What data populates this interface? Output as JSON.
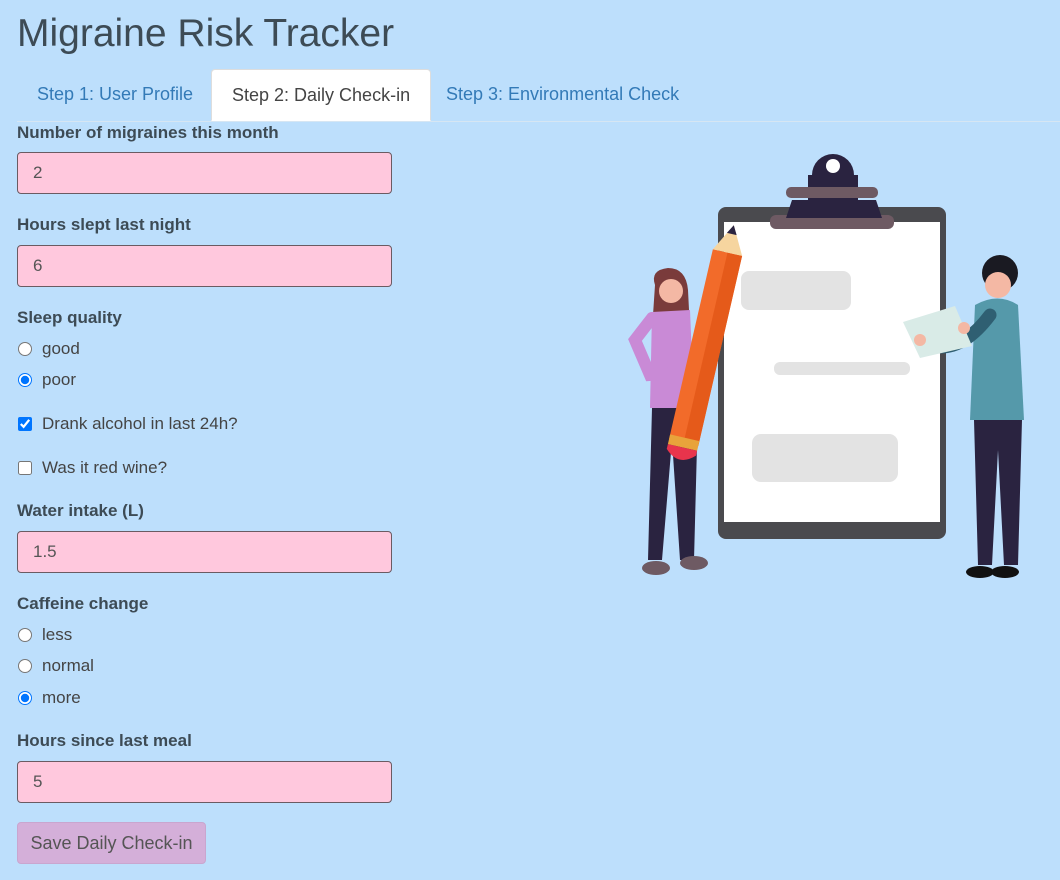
{
  "app": {
    "title": "Migraine Risk Tracker"
  },
  "tabs": [
    {
      "label": "Step 1: User Profile",
      "active": false
    },
    {
      "label": "Step 2: Daily Check-in",
      "active": true
    },
    {
      "label": "Step 3: Environmental Check",
      "active": false
    }
  ],
  "form": {
    "migraines": {
      "label": "Number of migraines this month",
      "value": "2"
    },
    "sleep_hours": {
      "label": "Hours slept last night",
      "value": "6"
    },
    "sleep_quality": {
      "label": "Sleep quality",
      "options": [
        "good",
        "poor"
      ],
      "selected": "poor"
    },
    "alcohol": {
      "label": "Drank alcohol in last 24h?",
      "checked": true
    },
    "red_wine": {
      "label": "Was it red wine?",
      "checked": false
    },
    "water": {
      "label": "Water intake (L)",
      "value": "1.5"
    },
    "caffeine": {
      "label": "Caffeine change",
      "options": [
        "less",
        "normal",
        "more"
      ],
      "selected": "more"
    },
    "meal": {
      "label": "Hours since last meal",
      "value": "5"
    },
    "save_label": "Save Daily Check-in"
  },
  "colors": {
    "background": "#bddffc",
    "input_bg": "#ffc8dd",
    "button_bg": "#d4afd9",
    "tab_link": "#337ab7"
  },
  "illustration": {
    "icon": "clipboard-people-illustration"
  }
}
